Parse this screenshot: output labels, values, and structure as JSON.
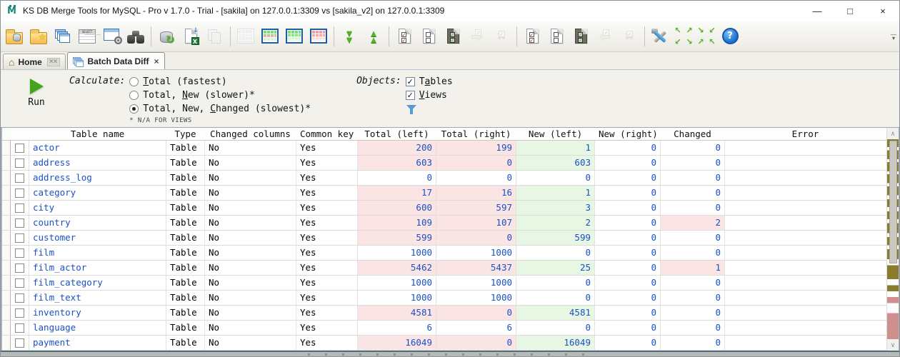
{
  "window": {
    "title": "KS DB Merge Tools for MySQL - Pro v 1.7.0 - Trial - [sakila] on 127.0.0.1:3309 vs [sakila_v2] on 127.0.0.1:3309",
    "logo_letter": "M",
    "controls": {
      "minimize": "—",
      "maximize": "□",
      "close": "×"
    }
  },
  "toolbar": {
    "items": [
      "open-comparison",
      "new-comparison",
      "object-tabs",
      "select-query",
      "table-options",
      "search",
      "refresh-database",
      "export-excel",
      "copy",
      "show-equal-rows",
      "show-changed-rows",
      "show-new-left-rows",
      "show-new-right-rows",
      "expand-all",
      "collapse-all",
      "check-all-left",
      "uncheck-all-left",
      "invert-checks-left",
      "apply-selected-to-right",
      "discard-left",
      "check-all-right",
      "uncheck-all-right",
      "invert-checks-right",
      "apply-selected-to-left",
      "discard-right",
      "tools",
      "navigation-arrows",
      "help"
    ]
  },
  "tabs": {
    "home": {
      "label": "Home",
      "close": "××"
    },
    "batch": {
      "label": "Batch Data Diff",
      "close": "×"
    }
  },
  "options": {
    "run_label": "Run",
    "calculate_label": "Calculate:",
    "radios": [
      {
        "pre": "",
        "key": "T",
        "post": "otal (fastest)",
        "selected": false
      },
      {
        "pre": "Total, ",
        "key": "N",
        "post": "ew (slower)*",
        "selected": false
      },
      {
        "pre": "Total, New, ",
        "key": "C",
        "post": "hanged (slowest)*",
        "selected": true
      }
    ],
    "footnote": "* N/A FOR VIEWS",
    "objects_label": "Objects:",
    "checkboxes": [
      {
        "pre": "T",
        "key": "a",
        "post": "bles",
        "checked": true,
        "mark": "✓"
      },
      {
        "pre": "",
        "key": "V",
        "post": "iews",
        "checked": true,
        "mark": "✓"
      }
    ]
  },
  "grid": {
    "columns": [
      "",
      "",
      "Table name",
      "Type",
      "Changed columns",
      "Common key",
      "Total (left)",
      "Total (right)",
      "New (left)",
      "New (right)",
      "Changed",
      "Error"
    ],
    "rows": [
      {
        "name": "actor",
        "type": "Table",
        "changed_columns": "No",
        "common_key": "Yes",
        "error": "",
        "cells": [
          {
            "v": "200",
            "bg": "pink"
          },
          {
            "v": "199",
            "bg": "pink"
          },
          {
            "v": "1",
            "bg": "green"
          },
          {
            "v": "0",
            "bg": ""
          },
          {
            "v": "0",
            "bg": ""
          }
        ]
      },
      {
        "name": "address",
        "type": "Table",
        "changed_columns": "No",
        "common_key": "Yes",
        "error": "",
        "cells": [
          {
            "v": "603",
            "bg": "pink"
          },
          {
            "v": "0",
            "bg": "pink"
          },
          {
            "v": "603",
            "bg": "green"
          },
          {
            "v": "0",
            "bg": ""
          },
          {
            "v": "0",
            "bg": ""
          }
        ]
      },
      {
        "name": "address_log",
        "type": "Table",
        "changed_columns": "No",
        "common_key": "Yes",
        "error": "",
        "cells": [
          {
            "v": "0",
            "bg": ""
          },
          {
            "v": "0",
            "bg": ""
          },
          {
            "v": "0",
            "bg": ""
          },
          {
            "v": "0",
            "bg": ""
          },
          {
            "v": "0",
            "bg": ""
          }
        ]
      },
      {
        "name": "category",
        "type": "Table",
        "changed_columns": "No",
        "common_key": "Yes",
        "error": "",
        "cells": [
          {
            "v": "17",
            "bg": "pink"
          },
          {
            "v": "16",
            "bg": "pink"
          },
          {
            "v": "1",
            "bg": "green"
          },
          {
            "v": "0",
            "bg": ""
          },
          {
            "v": "0",
            "bg": ""
          }
        ]
      },
      {
        "name": "city",
        "type": "Table",
        "changed_columns": "No",
        "common_key": "Yes",
        "error": "",
        "cells": [
          {
            "v": "600",
            "bg": "pink"
          },
          {
            "v": "597",
            "bg": "pink"
          },
          {
            "v": "3",
            "bg": "green"
          },
          {
            "v": "0",
            "bg": ""
          },
          {
            "v": "0",
            "bg": ""
          }
        ]
      },
      {
        "name": "country",
        "type": "Table",
        "changed_columns": "No",
        "common_key": "Yes",
        "error": "",
        "cells": [
          {
            "v": "109",
            "bg": "pink"
          },
          {
            "v": "107",
            "bg": "pink"
          },
          {
            "v": "2",
            "bg": "green"
          },
          {
            "v": "0",
            "bg": ""
          },
          {
            "v": "2",
            "bg": "pink"
          }
        ]
      },
      {
        "name": "customer",
        "type": "Table",
        "changed_columns": "No",
        "common_key": "Yes",
        "error": "",
        "cells": [
          {
            "v": "599",
            "bg": "pink"
          },
          {
            "v": "0",
            "bg": "pink"
          },
          {
            "v": "599",
            "bg": "green"
          },
          {
            "v": "0",
            "bg": ""
          },
          {
            "v": "0",
            "bg": ""
          }
        ]
      },
      {
        "name": "film",
        "type": "Table",
        "changed_columns": "No",
        "common_key": "Yes",
        "error": "",
        "cells": [
          {
            "v": "1000",
            "bg": ""
          },
          {
            "v": "1000",
            "bg": ""
          },
          {
            "v": "0",
            "bg": ""
          },
          {
            "v": "0",
            "bg": ""
          },
          {
            "v": "0",
            "bg": ""
          }
        ]
      },
      {
        "name": "film_actor",
        "type": "Table",
        "changed_columns": "No",
        "common_key": "Yes",
        "error": "",
        "cells": [
          {
            "v": "5462",
            "bg": "pink"
          },
          {
            "v": "5437",
            "bg": "pink"
          },
          {
            "v": "25",
            "bg": "green"
          },
          {
            "v": "0",
            "bg": ""
          },
          {
            "v": "1",
            "bg": "pink"
          }
        ]
      },
      {
        "name": "film_category",
        "type": "Table",
        "changed_columns": "No",
        "common_key": "Yes",
        "error": "",
        "cells": [
          {
            "v": "1000",
            "bg": ""
          },
          {
            "v": "1000",
            "bg": ""
          },
          {
            "v": "0",
            "bg": ""
          },
          {
            "v": "0",
            "bg": ""
          },
          {
            "v": "0",
            "bg": ""
          }
        ]
      },
      {
        "name": "film_text",
        "type": "Table",
        "changed_columns": "No",
        "common_key": "Yes",
        "error": "",
        "cells": [
          {
            "v": "1000",
            "bg": ""
          },
          {
            "v": "1000",
            "bg": ""
          },
          {
            "v": "0",
            "bg": ""
          },
          {
            "v": "0",
            "bg": ""
          },
          {
            "v": "0",
            "bg": ""
          }
        ]
      },
      {
        "name": "inventory",
        "type": "Table",
        "changed_columns": "No",
        "common_key": "Yes",
        "error": "",
        "cells": [
          {
            "v": "4581",
            "bg": "pink"
          },
          {
            "v": "0",
            "bg": "pink"
          },
          {
            "v": "4581",
            "bg": "green"
          },
          {
            "v": "0",
            "bg": ""
          },
          {
            "v": "0",
            "bg": ""
          }
        ]
      },
      {
        "name": "language",
        "type": "Table",
        "changed_columns": "No",
        "common_key": "Yes",
        "error": "",
        "cells": [
          {
            "v": "6",
            "bg": ""
          },
          {
            "v": "6",
            "bg": ""
          },
          {
            "v": "0",
            "bg": ""
          },
          {
            "v": "0",
            "bg": ""
          },
          {
            "v": "0",
            "bg": ""
          }
        ]
      },
      {
        "name": "payment",
        "type": "Table",
        "changed_columns": "No",
        "common_key": "Yes",
        "error": "",
        "cells": [
          {
            "v": "16049",
            "bg": "pink"
          },
          {
            "v": "0",
            "bg": "pink"
          },
          {
            "v": "16049",
            "bg": "green"
          },
          {
            "v": "0",
            "bg": ""
          },
          {
            "v": "0",
            "bg": ""
          }
        ]
      }
    ],
    "partial_row": {
      "cells": [
        "pink",
        "pink",
        "green",
        "",
        ""
      ]
    }
  },
  "colors": {
    "value_text": "#1a50c8",
    "diff_pink_bg": "#fbe4e4",
    "new_green_bg": "#e7f7e3",
    "scrollmap_changed": "#8a7b2d",
    "scrollmap_new": "#cf8f8f"
  }
}
